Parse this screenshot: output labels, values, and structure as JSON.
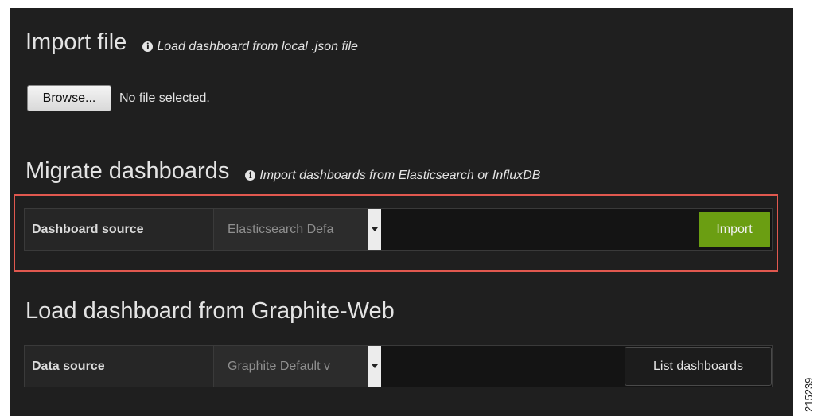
{
  "import_file": {
    "title": "Import file",
    "hint": "Load dashboard from local .json file",
    "browse_label": "Browse...",
    "file_status": "No file selected."
  },
  "migrate": {
    "title": "Migrate dashboards",
    "hint": "Import dashboards from Elasticsearch or InfluxDB",
    "source_label": "Dashboard source",
    "source_value": "Elasticsearch Defa",
    "import_label": "Import"
  },
  "graphite": {
    "title": "Load dashboard from Graphite-Web",
    "source_label": "Data source",
    "source_value": "Graphite Default v",
    "list_label": "List dashboards"
  },
  "icons": {
    "info": "info-icon",
    "dropdown": "caret-down-icon"
  },
  "colors": {
    "background": "#1f1f1f",
    "import_button": "#6b9e12",
    "highlight_border": "#e0584f"
  },
  "figure_id": "215239"
}
